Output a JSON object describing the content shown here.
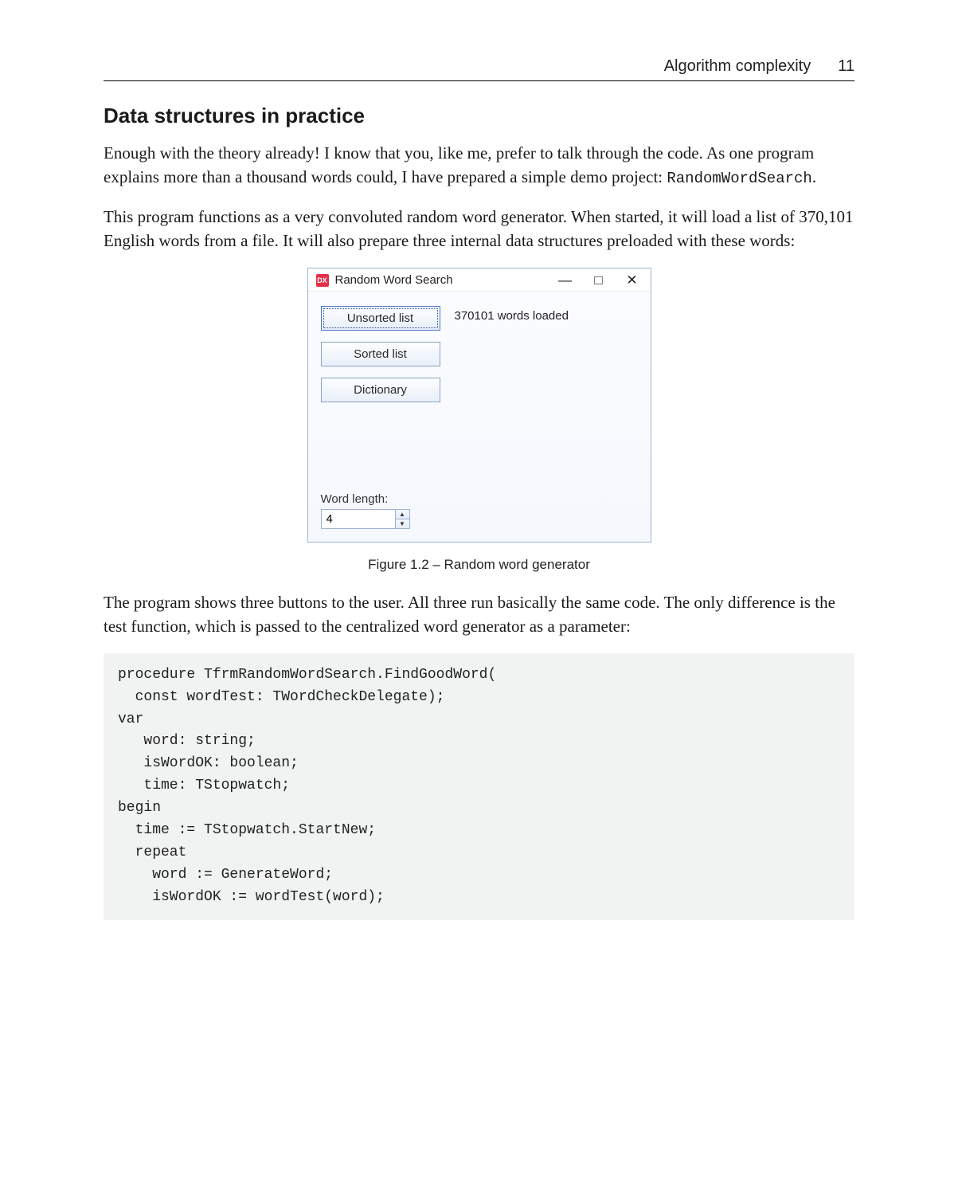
{
  "header": {
    "running_title": "Algorithm complexity",
    "page_number": "11"
  },
  "section": {
    "title": "Data structures in practice"
  },
  "paragraphs": {
    "p1a": "Enough with the theory already! I know that you, like me, prefer to talk through the code. As one program explains more than a thousand words could, I have prepared a simple demo project: ",
    "p1_code": "RandomWordSearch",
    "p1b": ".",
    "p2": "This program functions as a very convoluted random word generator. When started, it will load a list of 370,101 English words from a file. It will also prepare three internal data structures preloaded with these words:",
    "p3": "The program shows three buttons to the user. All three run basically the same code. The only difference is the test function, which is passed to the centralized word generator as a parameter:"
  },
  "figure": {
    "caption": "Figure 1.2 – Random word generator",
    "window": {
      "app_icon_text": "DX",
      "title": "Random Word Search",
      "status": "370101 words loaded",
      "buttons": {
        "unsorted": "Unsorted list",
        "sorted": "Sorted list",
        "dictionary": "Dictionary"
      },
      "word_length_label": "Word length:",
      "word_length_value": "4"
    }
  },
  "code": "procedure TfrmRandomWordSearch.FindGoodWord(\n  const wordTest: TWordCheckDelegate);\nvar\n   word: string;\n   isWordOK: boolean;\n   time: TStopwatch;\nbegin\n  time := TStopwatch.StartNew;\n  repeat\n    word := GenerateWord;\n    isWordOK := wordTest(word);"
}
